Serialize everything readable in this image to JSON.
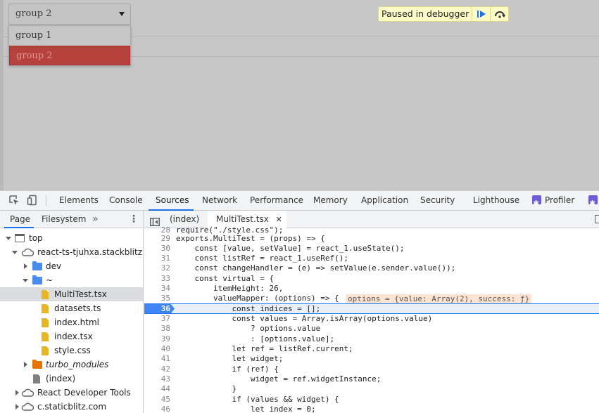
{
  "page": {
    "dropdown": {
      "value": "group 2",
      "options": [
        {
          "label": "group 1",
          "selected": false
        },
        {
          "label": "group 2",
          "selected": true
        }
      ]
    },
    "debugger_banner": {
      "text": "Paused in debugger",
      "resume_icon": "resume-icon",
      "step_over_icon": "step-over-icon"
    },
    "overlay_color": "#c7c7c7"
  },
  "devtools": {
    "tabs": [
      {
        "label": "Elements",
        "active": false
      },
      {
        "label": "Console",
        "active": false
      },
      {
        "label": "Sources",
        "active": true
      },
      {
        "label": "Network",
        "active": false
      },
      {
        "label": "Performance",
        "active": false
      },
      {
        "label": "Memory",
        "active": false
      },
      {
        "label": "Application",
        "active": false
      },
      {
        "label": "Security",
        "active": false
      },
      {
        "label": "Lighthouse",
        "active": false
      },
      {
        "label": "Profiler",
        "active": false
      }
    ],
    "accent_color": "#1a73e8"
  },
  "navigator": {
    "tabs": [
      {
        "label": "Page",
        "active": true
      },
      {
        "label": "Filesystem",
        "active": false
      }
    ],
    "more": "»",
    "tree": [
      {
        "label": "top",
        "icon": "frame-icon",
        "expanded": true
      },
      {
        "label": "react-ts-tjuhxa.stackblitz.io",
        "icon": "cloud-icon",
        "expanded": true
      },
      {
        "label": "dev",
        "icon": "folder-icon",
        "expanded": false
      },
      {
        "label": "~",
        "icon": "folder-icon",
        "expanded": true
      },
      {
        "label": "MultiTest.tsx",
        "icon": "file-icon",
        "selected": true
      },
      {
        "label": "datasets.ts",
        "icon": "file-icon"
      },
      {
        "label": "index.html",
        "icon": "file-icon"
      },
      {
        "label": "index.tsx",
        "icon": "file-icon"
      },
      {
        "label": "style.css",
        "icon": "file-icon"
      },
      {
        "label": "turbo_modules",
        "icon": "folder-icon",
        "expanded": false
      },
      {
        "label": "(index)",
        "icon": "file-icon"
      },
      {
        "label": "React Developer Tools",
        "icon": "cloud-icon",
        "expanded": false
      },
      {
        "label": "c.staticblitz.com",
        "icon": "cloud-icon",
        "expanded": false
      }
    ]
  },
  "editor": {
    "tabs": [
      {
        "label": "(index)",
        "active": false
      },
      {
        "label": "MultiTest.tsx",
        "active": true,
        "closable": true
      }
    ],
    "close_glyph": "✕",
    "execution_line": 36,
    "inline_value": "options = {value: Array(2), success: ƒ}",
    "lines": [
      {
        "n": "28",
        "text": "require(\"./style.css\");"
      },
      {
        "n": "29",
        "text": "exports.MultiTest = (props) => {"
      },
      {
        "n": "30",
        "text": "    const [value, setValue] = react_1.useState();"
      },
      {
        "n": "31",
        "text": "    const listRef = react_1.useRef();"
      },
      {
        "n": "32",
        "text": "    const changeHandler = (e) => setValue(e.sender.value());"
      },
      {
        "n": "33",
        "text": "    const virtual = {"
      },
      {
        "n": "34",
        "text": "        itemHeight: 26,"
      },
      {
        "n": "35",
        "text": "        valueMapper: (options) => {"
      },
      {
        "n": "36",
        "text": "            const indices = [];"
      },
      {
        "n": "37",
        "text": "            const values = Array.isArray(options.value)"
      },
      {
        "n": "38",
        "text": "                ? options.value"
      },
      {
        "n": "39",
        "text": "                : [options.value];"
      },
      {
        "n": "40",
        "text": "            let ref = listRef.current;"
      },
      {
        "n": "41",
        "text": "            let widget;"
      },
      {
        "n": "42",
        "text": "            if (ref) {"
      },
      {
        "n": "43",
        "text": "                widget = ref.widgetInstance;"
      },
      {
        "n": "44",
        "text": "            }"
      },
      {
        "n": "45",
        "text": "            if (values && widget) {"
      },
      {
        "n": "46",
        "text": "                let index = 0;"
      }
    ]
  }
}
